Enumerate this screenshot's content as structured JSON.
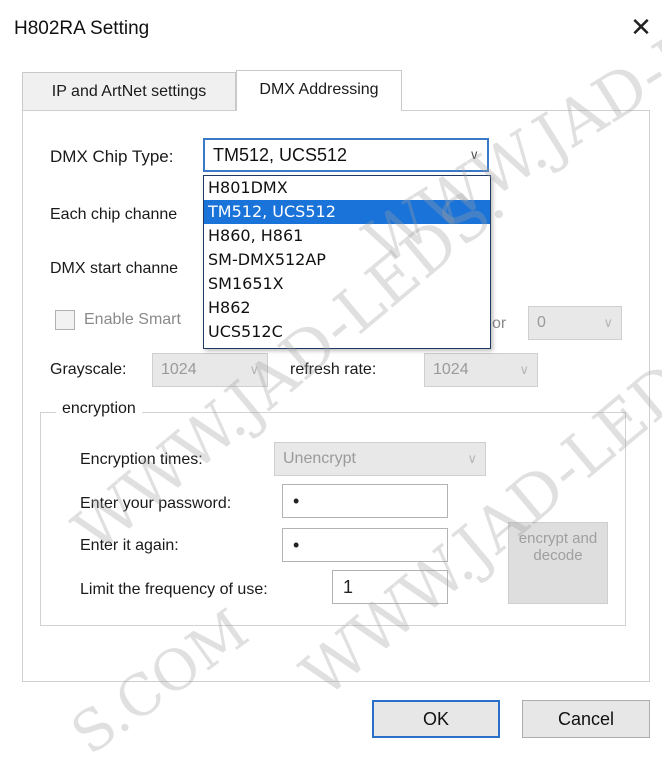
{
  "window": {
    "title": "H802RA Setting",
    "close_glyph": "✕"
  },
  "tabs": [
    {
      "label": "IP and ArtNet settings",
      "active": false
    },
    {
      "label": "DMX Addressing",
      "active": true
    }
  ],
  "dmx": {
    "chip_type_label": "DMX Chip Type:",
    "chip_type_value": "TM512, UCS512",
    "chip_options": [
      "H801DMX",
      "TM512, UCS512",
      "H860, H861",
      "SM-DMX512AP",
      "SM1651X",
      "H862",
      "UCS512C"
    ],
    "selected_index": 1,
    "each_chip_label": "Each chip channe",
    "start_channel_label": "DMX start channe",
    "enable_smart_label": "Enable Smart",
    "enable_smart_checked": false,
    "right_partial_label": "or",
    "right_combo_value": "0",
    "grayscale_label": "Grayscale:",
    "grayscale_value": "1024",
    "refresh_label": "refresh rate:",
    "refresh_value": "1024"
  },
  "encryption": {
    "group_title": "encryption",
    "times_label": "Encryption times:",
    "times_value": "Unencrypt",
    "password_label": "Enter your password:",
    "password_value": "•",
    "again_label": "Enter it again:",
    "again_value": "•",
    "limit_label": "Limit the frequency of use:",
    "limit_value": "1",
    "encrypt_button": "encrypt and decode"
  },
  "footer": {
    "ok_label": "OK",
    "cancel_label": "Cancel"
  },
  "icons": {
    "dropdown_chevron": "chevron-down-icon"
  },
  "watermark": {
    "line1": "WWW.JAD-LEDS.",
    "line2": "WWW.JAD-LEDS.",
    "line3": "S.COM",
    "line4": "WWW.JAD-LEDS"
  },
  "colors": {
    "selection": "#1a73d9",
    "focus_border": "#3a78c8",
    "default_button_border": "#2a6fc9"
  }
}
